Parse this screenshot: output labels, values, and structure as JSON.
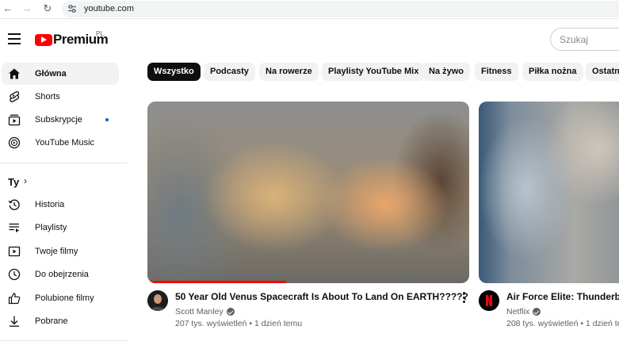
{
  "browser": {
    "url": "youtube.com"
  },
  "header": {
    "logo_text": "Premium",
    "country_code": "PL",
    "search_placeholder": "Szukaj"
  },
  "sidebar": {
    "main_items": [
      {
        "label": "Główna",
        "icon": "home-icon",
        "active": true
      },
      {
        "label": "Shorts",
        "icon": "shorts-icon"
      },
      {
        "label": "Subskrypcje",
        "icon": "subscriptions-icon",
        "new_dot": true
      },
      {
        "label": "YouTube Music",
        "icon": "youtube-music-icon"
      }
    ],
    "you_section": {
      "title": "Ty",
      "arrow": "›",
      "items": [
        {
          "label": "Historia",
          "icon": "history-icon"
        },
        {
          "label": "Playlisty",
          "icon": "playlists-icon"
        },
        {
          "label": "Twoje filmy",
          "icon": "your-videos-icon"
        },
        {
          "label": "Do obejrzenia",
          "icon": "watch-later-icon"
        },
        {
          "label": "Polubione filmy",
          "icon": "liked-icon"
        },
        {
          "label": "Pobrane",
          "icon": "download-icon"
        }
      ]
    }
  },
  "chips": [
    {
      "label": "Wszystko",
      "active": true
    },
    {
      "label": "Podcasty"
    },
    {
      "label": "Na rowerze"
    },
    {
      "label": "Playlisty YouTube Mix"
    },
    {
      "label": "Na żywo"
    },
    {
      "label": "Fitness"
    },
    {
      "label": "Piłka nożna"
    },
    {
      "label": "Ostatni"
    }
  ],
  "videos": [
    {
      "title": "50 Year Old Venus Spacecraft Is About To Land On EARTH?????",
      "channel": "Scott Manley",
      "verified": true,
      "meta": "207 tys. wyświetleń • 1 dzień temu",
      "watched_progress": 0.43,
      "avatar_icon": "channel-avatar"
    },
    {
      "title": "Air Force Elite: Thunderbird",
      "channel": "Netflix",
      "verified": true,
      "meta": "208 tys. wyświetleń • 1 dzień te",
      "avatar_icon": "netflix-logo-icon"
    }
  ],
  "colors": {
    "brand_red": "#ff0000",
    "chip_active_bg": "#0f0f0f",
    "chip_bg": "#f2f2f2",
    "secondary_text": "#606060",
    "notification_dot": "#065fd4"
  }
}
